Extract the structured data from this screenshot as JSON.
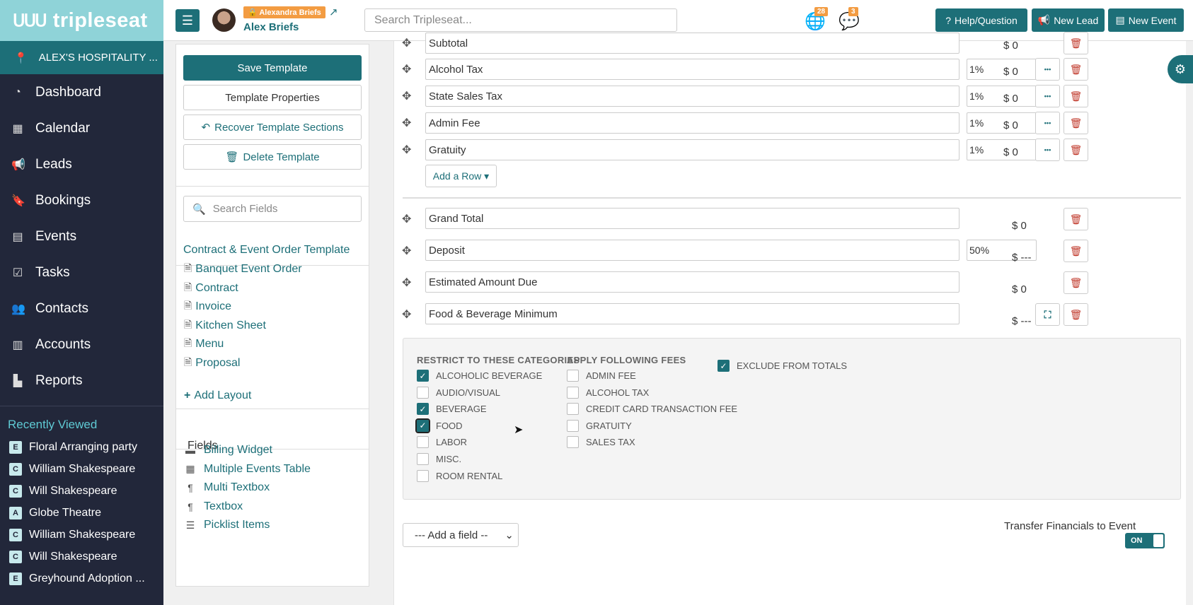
{
  "brand": {
    "logo_text": "tripleseat",
    "logo_mark": "ᑌᑌᑌ"
  },
  "sidebar": {
    "location": "ALEX'S HOSPITALITY ...",
    "nav": [
      {
        "label": "Dashboard",
        "icon": "dashboard-icon",
        "glyph": "◔"
      },
      {
        "label": "Calendar",
        "icon": "calendar-icon",
        "glyph": "▦"
      },
      {
        "label": "Leads",
        "icon": "megaphone-icon",
        "glyph": "📢"
      },
      {
        "label": "Bookings",
        "icon": "bookmark-icon",
        "glyph": "🔖"
      },
      {
        "label": "Events",
        "icon": "book-icon",
        "glyph": "▤"
      },
      {
        "label": "Tasks",
        "icon": "check-square-icon",
        "glyph": "☑"
      },
      {
        "label": "Contacts",
        "icon": "users-icon",
        "glyph": "👥"
      },
      {
        "label": "Accounts",
        "icon": "building-icon",
        "glyph": "▥"
      },
      {
        "label": "Reports",
        "icon": "bar-chart-icon",
        "glyph": "▙"
      }
    ],
    "recent_title": "Recently Viewed",
    "recent": [
      {
        "badge": "E",
        "label": "Floral Arranging party"
      },
      {
        "badge": "C",
        "label": "William Shakespeare"
      },
      {
        "badge": "C",
        "label": "Will Shakespeare"
      },
      {
        "badge": "A",
        "label": "Globe Theatre"
      },
      {
        "badge": "C",
        "label": "William Shakespeare"
      },
      {
        "badge": "C",
        "label": "Will Shakespeare"
      },
      {
        "badge": "E",
        "label": "Greyhound Adoption ..."
      }
    ]
  },
  "topbar": {
    "user_tag": "Alexandra Briefs",
    "user_name": "Alex Briefs",
    "search_placeholder": "Search Tripleseat...",
    "globe_count": "28",
    "chat_count": "3",
    "help_label": "Help/Question",
    "new_lead_label": "New Lead",
    "new_event_label": "New Event"
  },
  "left_panel": {
    "save_label": "Save Template",
    "properties_label": "Template Properties",
    "recover_label": "Recover Template Sections",
    "delete_label": "Delete Template",
    "search_placeholder": "Search Fields",
    "template_title": "Contract & Event Order Template",
    "layouts": [
      "Banquet Event Order",
      "Contract",
      "Invoice",
      "Kitchen Sheet",
      "Menu",
      "Proposal"
    ],
    "add_layout_label": "Add Layout",
    "fields_title": "Fields",
    "fields": [
      {
        "label": "Billing Widget",
        "icon": "money-icon",
        "glyph": "▬"
      },
      {
        "label": "Multiple Events Table",
        "icon": "table-icon",
        "glyph": "▦"
      },
      {
        "label": "Multi Textbox",
        "icon": "paragraph-icon",
        "glyph": "¶"
      },
      {
        "label": "Textbox",
        "icon": "paragraph-icon",
        "glyph": "¶"
      },
      {
        "label": "Picklist Items",
        "icon": "list-icon",
        "glyph": "☰"
      }
    ]
  },
  "main": {
    "rows": [
      {
        "label": "Subtotal",
        "pct": "",
        "amount": "$ 0"
      },
      {
        "label": "Alcohol Tax",
        "pct": "1%",
        "amount": "$ 0"
      },
      {
        "label": "State Sales Tax",
        "pct": "1%",
        "amount": "$ 0"
      },
      {
        "label": "Admin Fee",
        "pct": "1%",
        "amount": "$ 0"
      },
      {
        "label": "Gratuity",
        "pct": "1%",
        "amount": "$ 0"
      }
    ],
    "add_row_label": "Add a Row ▾",
    "totals": [
      {
        "label": "Grand Total",
        "pct": "",
        "amount": "$ 0"
      },
      {
        "label": "Deposit",
        "pct": "50%",
        "amount": "$ ---"
      },
      {
        "label": "Estimated Amount Due",
        "pct": "",
        "amount": "$ 0"
      },
      {
        "label": "Food & Beverage Minimum",
        "pct": "",
        "amount": "$ ---"
      }
    ],
    "restrict_title": "RESTRICT TO THESE CATEGORIES",
    "categories": [
      {
        "label": "ALCOHOLIC BEVERAGE",
        "checked": true
      },
      {
        "label": "AUDIO/VISUAL",
        "checked": false
      },
      {
        "label": "BEVERAGE",
        "checked": true
      },
      {
        "label": "FOOD",
        "checked": true
      },
      {
        "label": "LABOR",
        "checked": false
      },
      {
        "label": "MISC.",
        "checked": false
      },
      {
        "label": "ROOM RENTAL",
        "checked": false
      }
    ],
    "fees_title": "APPLY FOLLOWING FEES",
    "fees": [
      {
        "label": "ADMIN FEE",
        "checked": false
      },
      {
        "label": "ALCOHOL TAX",
        "checked": false
      },
      {
        "label": "CREDIT CARD TRANSACTION FEE",
        "checked": false
      },
      {
        "label": "GRATUITY",
        "checked": false
      },
      {
        "label": "SALES TAX",
        "checked": false
      }
    ],
    "exclude_label": "EXCLUDE FROM TOTALS",
    "exclude_checked": true,
    "add_field_label": "--- Add a field --",
    "transfer_label": "Transfer Financials to Event",
    "toggle_label": "ON"
  },
  "colors": {
    "accent": "#1d6f78",
    "sidebar_bg": "#22273a",
    "logo_bg": "#8fd3d8",
    "badge": "#f39c42",
    "danger": "#c0392b"
  }
}
